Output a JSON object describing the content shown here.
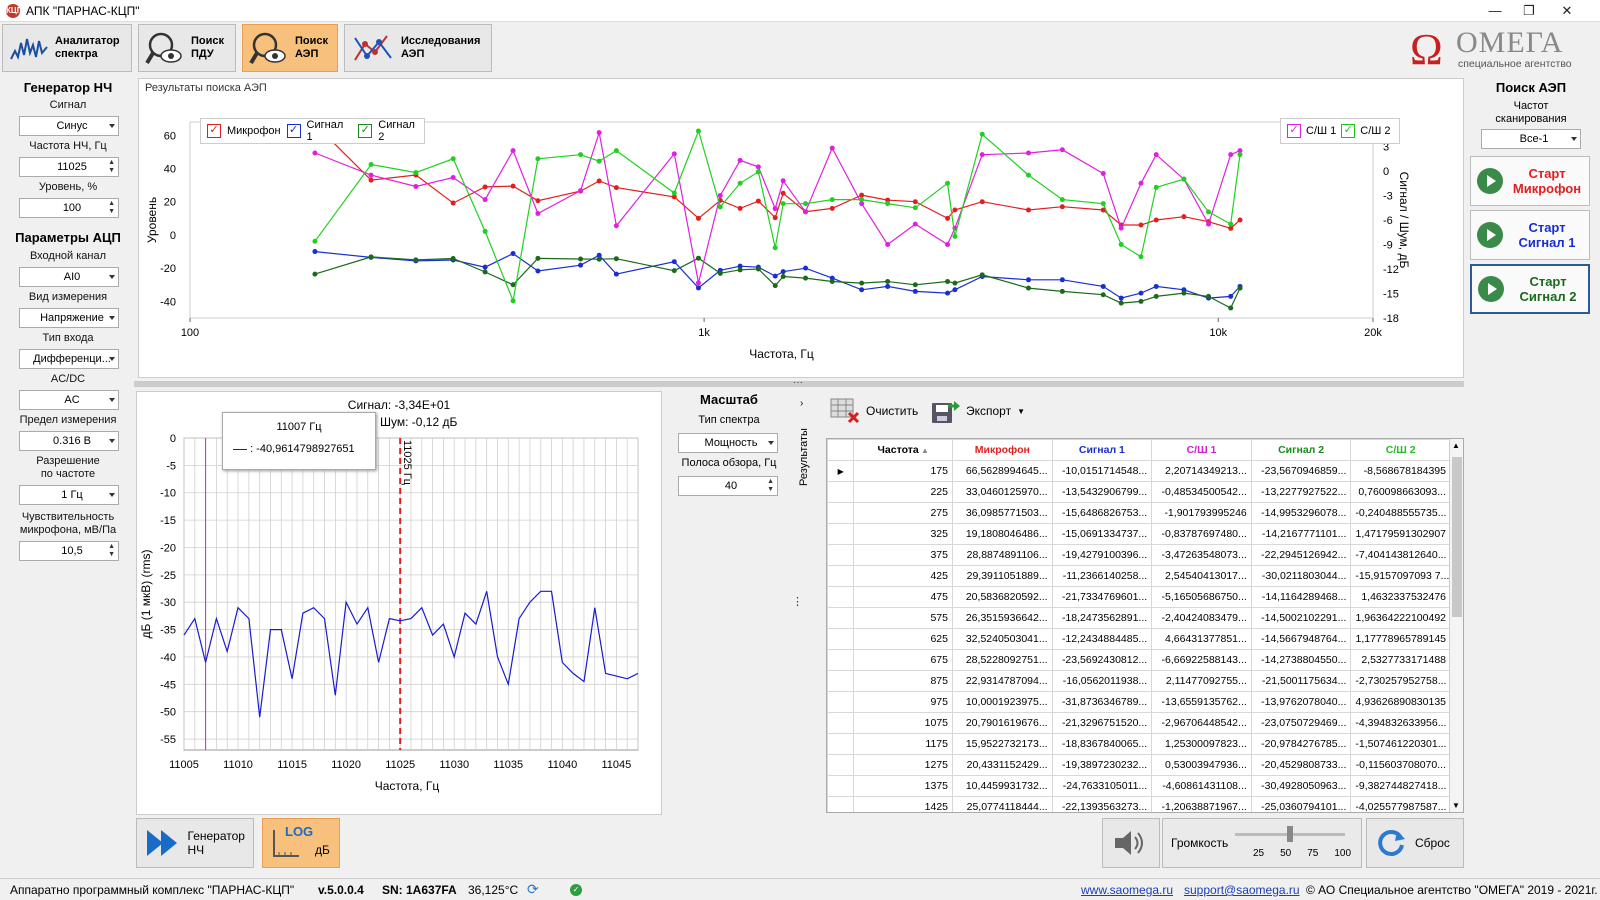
{
  "window": {
    "title": "АПК \"ПАРНАС-КЦП\"",
    "icon_text": "КЦП"
  },
  "toolbar": {
    "tabs": [
      {
        "label": "Аналитатор спектра"
      },
      {
        "label": "Поиск ПДУ"
      },
      {
        "label": "Поиск АЭП"
      },
      {
        "label": "Исследования АЭП"
      }
    ],
    "logo_text": "ОМЕГА",
    "logo_sub": "специальное агентство"
  },
  "left": {
    "gen_title": "Генератор НЧ",
    "signal_label": "Сигнал",
    "signal_value": "Синус",
    "freq_label": "Частота НЧ, Гц",
    "freq_value": "11025",
    "level_label": "Уровень, %",
    "level_value": "100",
    "adc_title": "Параметры АЦП",
    "input_label": "Входной канал",
    "input_value": "AI0",
    "meas_label": "Вид измерения",
    "meas_value": "Напряжение",
    "intype_label": "Тип входа",
    "intype_value": "Дифференци...",
    "acdc_label": "AC/DC",
    "acdc_value": "AC",
    "limit_label": "Предел измерения",
    "limit_value": "0.316 В",
    "res_label1": "Разрешение",
    "res_label2": "по частоте",
    "res_value": "1 Гц",
    "sens_label1": "Чувствительность",
    "sens_label2": "микрофона, мВ/Па",
    "sens_value": "10,5"
  },
  "right": {
    "title": "Поиск АЭП",
    "scan_label1": "Частот",
    "scan_label2": "сканирования",
    "scan_value": "Все-1",
    "start_mic": "Старт Микрофон",
    "start_s1": "Старт Сигнал 1",
    "start_s2": "Старт Сигнал 2"
  },
  "top_chart": {
    "group_title": "Результаты поиска АЭП",
    "legend_left": [
      "Микрофон",
      "Сигнал 1",
      "Сигнал 2"
    ],
    "legend_right": [
      "С/Ш 1",
      "С/Ш 2"
    ],
    "ylabel": "Уровень",
    "ylabel_right": "Сигнал / Шум, дБ",
    "xlabel": "Частота, Гц",
    "y_ticks": [
      "60",
      "40",
      "20",
      "0",
      "-20",
      "-40"
    ],
    "y2_ticks": [
      "6",
      "3",
      "0",
      "-3",
      "-6",
      "-9",
      "-12",
      "-15",
      "-18"
    ],
    "x_ticks": [
      "100",
      "1k",
      "10k",
      "20k"
    ]
  },
  "spectrum": {
    "signal_text": "Сигнал: -3,34E+01",
    "noise_text": "Шум: -0,12 дБ",
    "tooltip_title": "11007 Гц",
    "tooltip_value": ": -40,9614798927651",
    "marker_label": "11025 Гц",
    "ylabel": "дБ (1 мкВ) (rms)",
    "xlabel": "Частота, Гц",
    "y_ticks": [
      "0",
      "-5",
      "-10",
      "-15",
      "-20",
      "-25",
      "-30",
      "-35",
      "-40",
      "-45",
      "-50",
      "-55"
    ],
    "x_ticks": [
      "11005",
      "11010",
      "11015",
      "11020",
      "11025",
      "11030",
      "11035",
      "11040",
      "11045"
    ]
  },
  "scale": {
    "title": "Масштаб",
    "type_label": "Тип спектра",
    "type_value": "Мощность",
    "band_label": "Полоса обзора, Гц",
    "band_value": "40"
  },
  "results": {
    "side_label": "Результаты",
    "clear_label": "Очистить",
    "export_label": "Экспорт",
    "columns": [
      "Частота",
      "Микрофон",
      "Сигнал 1",
      "С/Ш 1",
      "Сигнал 2",
      "С/Ш 2"
    ],
    "column_colors": [
      "#000000",
      "#e02020",
      "#1a2fd0",
      "#d020d0",
      "#1a8a1a",
      "#20c020"
    ],
    "rows": [
      [
        "175",
        "66,5628994645...",
        "-10,0151714548...",
        "2,20714349213...",
        "-23,5670946859...",
        "-8,568678184395"
      ],
      [
        "225",
        "33,0460125970...",
        "-13,5432906799...",
        "-0,48534500542...",
        "-13,2277927522...",
        "0,760098663093..."
      ],
      [
        "275",
        "36,0985771503...",
        "-15,6486826753...",
        "-1,901793995246",
        "-14,9953296078...",
        "-0,240488555735..."
      ],
      [
        "325",
        "19,1808046486...",
        "-15,0691334737...",
        "-0,83787697480...",
        "-14,2167771101...",
        "1,47179591302907"
      ],
      [
        "375",
        "28,8874891106...",
        "-19,4279100396...",
        "-3,47263548073...",
        "-22,2945126942...",
        "-7,404143812640..."
      ],
      [
        "425",
        "29,3911051889...",
        "-11,2366140258...",
        "2,54540413017...",
        "-30,0211803044...",
        "-15,9157097093 7..."
      ],
      [
        "475",
        "20,5836820592...",
        "-21,7334769601...",
        "-5,16505686750...",
        "-14,1164289468...",
        "1,4632337532476"
      ],
      [
        "575",
        "26,3515936642...",
        "-18,2473562891...",
        "-2,40424083479...",
        "-14,5002102291...",
        "1,96364222100492"
      ],
      [
        "625",
        "32,5240503041...",
        "-12,2434884485...",
        "4,66431377851...",
        "-14,5667948764...",
        "1,17778965789145"
      ],
      [
        "675",
        "28,5228092751...",
        "-23,5692430812...",
        "-6,66922588143...",
        "-14,2738804550...",
        "2,5327733171488"
      ],
      [
        "875",
        "22,9314787094...",
        "-16,0562011938...",
        "2,11477092755...",
        "-21,5001175634...",
        "-2,730257952758..."
      ],
      [
        "975",
        "10,0001923975...",
        "-31,8736346789...",
        "-13,6559135762...",
        "-13,9762078040...",
        "4,93626890830135"
      ],
      [
        "1075",
        "20,7901619676...",
        "-21,3296751520...",
        "-2,96706448542...",
        "-23,0750729469...",
        "-4,394832633956..."
      ],
      [
        "1175",
        "15,9522732173...",
        "-18,8367840065...",
        "1,25300097823...",
        "-20,9784276785...",
        "-1,507461220301..."
      ],
      [
        "1275",
        "20,4331152429...",
        "-19,3897230232...",
        "0,53003947936...",
        "-20,4529808733...",
        "-0,115603708070..."
      ],
      [
        "1375",
        "10,4459931732...",
        "-24,7633105011...",
        "-4,60861431108...",
        "-30,4928050963...",
        "-9,382744827418..."
      ],
      [
        "1425",
        "25,0774118444...",
        "-22,1393563273...",
        "-1,20638871967...",
        "-25,0360794101...",
        "-4,025577987587..."
      ]
    ]
  },
  "bottom": {
    "gen_btn": "Генератор НЧ",
    "log_top": "LOG",
    "log_bottom": "дБ",
    "volume_label": "Громкость",
    "volume_ticks": [
      "25",
      "50",
      "75",
      "100"
    ],
    "volume_level": 50,
    "reset_label": "Сброс"
  },
  "status": {
    "product": "Аппаратно программный комплекс \"ПАРНАС-КЦП\"",
    "version": "v.5.0.0.4",
    "sn": "SN: 1A637FA",
    "temp": "36,125°С",
    "site": "www.saomega.ru",
    "email": "support@saomega.ru",
    "copyright": "© АО Специальное агентство \"ОМЕГА\" 2019 - 2021г."
  },
  "chart_data": [
    {
      "type": "line",
      "title": "",
      "xlabel": "Частота, Гц",
      "ylabel": "Уровень",
      "y2label": "Сигнал / Шум, дБ",
      "xscale": "log",
      "xlim": [
        100,
        20000
      ],
      "ylim": [
        -50,
        68
      ],
      "y2lim": [
        -18,
        6
      ],
      "x": [
        175,
        225,
        275,
        325,
        375,
        425,
        475,
        575,
        625,
        675,
        875,
        975,
        1075,
        1175,
        1275,
        1375,
        1425,
        1575,
        1775,
        2025,
        2275,
        2575,
        2975,
        3075,
        3475,
        4275,
        4975,
        5975,
        6475,
        7075,
        7575,
        8575,
        9575,
        10575,
        11025
      ],
      "series": [
        {
          "name": "Микрофон",
          "color": "#e02020",
          "axis": "left",
          "values": [
            66.6,
            33.0,
            36.1,
            19.2,
            28.9,
            29.4,
            20.6,
            26.4,
            32.5,
            28.5,
            22.9,
            10.0,
            20.8,
            16.0,
            20.4,
            10.4,
            25.1,
            14.0,
            16.0,
            24.0,
            21.0,
            20.0,
            10.0,
            15.0,
            20.0,
            15.0,
            17.0,
            15.0,
            6.0,
            6.0,
            9.0,
            11.0,
            8.0,
            4.0,
            9.0
          ]
        },
        {
          "name": "Сигнал 1",
          "color": "#1a2fd0",
          "axis": "left",
          "values": [
            -10.0,
            -13.5,
            -15.6,
            -15.1,
            -19.4,
            -11.2,
            -21.7,
            -18.2,
            -12.2,
            -23.6,
            -16.1,
            -31.9,
            -21.3,
            -18.8,
            -19.4,
            -24.8,
            -22.1,
            -20.0,
            -26.0,
            -33.0,
            -31.0,
            -34.0,
            -35.0,
            -33.0,
            -25.0,
            -27.0,
            -27.0,
            -31.0,
            -38.0,
            -35.0,
            -31.0,
            -33.0,
            -38.0,
            -37.0,
            -31.0
          ]
        },
        {
          "name": "Сигнал 2",
          "color": "#1a6a1a",
          "axis": "left",
          "values": [
            -23.6,
            -13.2,
            -15.0,
            -14.2,
            -22.3,
            -30.0,
            -14.1,
            -14.5,
            -14.6,
            -14.3,
            -21.5,
            -14.0,
            -23.1,
            -21.0,
            -20.5,
            -30.5,
            -25.0,
            -26.0,
            -28.0,
            -29.0,
            -28.0,
            -30.0,
            -28.0,
            -29.0,
            -24.0,
            -32.0,
            -34.0,
            -36.0,
            -41.0,
            -40.0,
            -37.0,
            -35.0,
            -37.0,
            -44.0,
            -32.0
          ]
        },
        {
          "name": "С/Ш 1",
          "color": "#e020e0",
          "axis": "right",
          "values": [
            2.2,
            -0.5,
            -1.9,
            -0.8,
            -3.5,
            2.5,
            -5.2,
            -2.4,
            4.7,
            -6.7,
            2.1,
            -13.7,
            -3.0,
            1.3,
            0.5,
            -4.6,
            -1.2,
            -5.0,
            2.8,
            -4.0,
            -9.0,
            -6.5,
            -9.0,
            -7.0,
            2.0,
            2.2,
            2.6,
            -0.3,
            -7.0,
            -1.5,
            2.0,
            -1.0,
            -6.5,
            2.0,
            2.5
          ]
        },
        {
          "name": "С/Ш 2",
          "color": "#20d020",
          "axis": "right",
          "values": [
            -8.6,
            0.8,
            -0.2,
            1.5,
            -7.4,
            -15.9,
            1.5,
            2.0,
            1.2,
            2.5,
            -2.7,
            4.9,
            -4.4,
            -1.5,
            -0.1,
            -9.4,
            -4.0,
            -4.0,
            -3.5,
            -3.5,
            -4.0,
            -4.5,
            -1.5,
            -8.0,
            4.5,
            -0.5,
            -3.5,
            -4.0,
            -9.0,
            -10.5,
            -2.0,
            -1.0,
            -5.0,
            -6.5,
            2.0
          ]
        }
      ]
    },
    {
      "type": "line",
      "title": "",
      "xlabel": "Частота, Гц",
      "ylabel": "дБ (1 мкВ) (rms)",
      "xlim": [
        11005,
        11047
      ],
      "ylim": [
        -57,
        0
      ],
      "marker_x": 11025,
      "cursor_x": 11007,
      "series": [
        {
          "name": "",
          "color": "#1a1ad0",
          "x": [
            11005,
            11006,
            11007,
            11008,
            11009,
            11010,
            11011,
            11012,
            11013,
            11014,
            11015,
            11016,
            11017,
            11018,
            11019,
            11020,
            11021,
            11022,
            11023,
            11024,
            11025,
            11026,
            11027,
            11028,
            11029,
            11030,
            11031,
            11032,
            11033,
            11034,
            11035,
            11036,
            11037,
            11038,
            11039,
            11040,
            11041,
            11042,
            11043,
            11044,
            11045,
            11046,
            11047
          ],
          "values": [
            -36,
            -33,
            -41,
            -33,
            -39,
            -31,
            -33,
            -51,
            -35,
            -35,
            -44,
            -32,
            -31,
            -33,
            -47,
            -30,
            -34,
            -31,
            -41,
            -33,
            -33.4,
            -33,
            -31,
            -36,
            -34,
            -40,
            -32,
            -34,
            -28,
            -40,
            -45,
            -33,
            -30,
            -28,
            -28,
            -41,
            -43,
            -44.5,
            -31,
            -43,
            -43.5,
            -44,
            -43
          ]
        }
      ]
    }
  ]
}
